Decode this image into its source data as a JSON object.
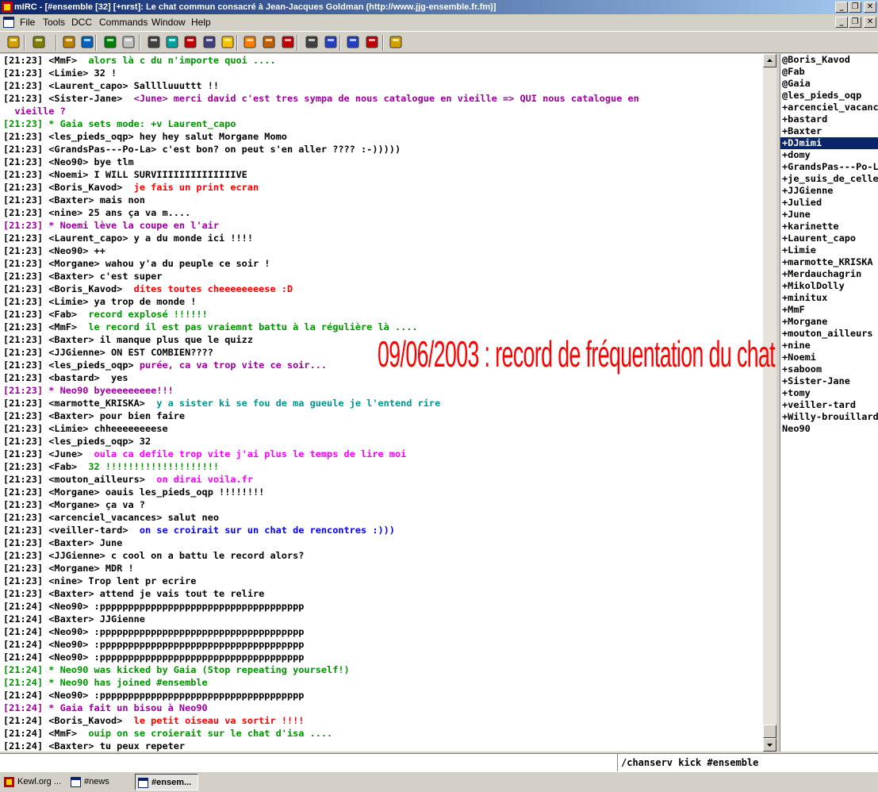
{
  "window": {
    "title": "mIRC - [#ensemble [32] [+nrst]: Le chat commun consacré à Jean-Jacques Goldman (http://www.jjg-ensemble.fr.fm)]"
  },
  "menu": [
    "File",
    "Tools",
    "DCC",
    "Commands",
    "Window",
    "Help"
  ],
  "toolbar_icons": [
    "connect-icon",
    "options-icon",
    "address-book-icon",
    "channels-icon",
    "scripts-icon",
    "timer-icon",
    "colors-icon",
    "notify-icon",
    "urls-icon",
    "logs-icon",
    "dcc-send-icon",
    "dcc-chat-icon",
    "dcc-options-icon",
    "tile-icon",
    "cascade-icon",
    "help-icon",
    "about-icon",
    "online-timer-icon",
    "colors-2-icon"
  ],
  "colors": {
    "black": "#000000",
    "green": "#009300",
    "purple": "#9c009c",
    "red": "#fc0000",
    "teal": "#009393",
    "magenta": "#ff00ff",
    "blue": "#0000fc",
    "selection": "#0a246a",
    "watermark": "#ff0000"
  },
  "chat_lines": [
    {
      "t": "[21:23] <MmF>  ",
      "m": "alors là c du n'importe quoi ....",
      "c": "green"
    },
    {
      "t": "[21:23] <Limie> 32 !",
      "m": "",
      "c": "black"
    },
    {
      "t": "[21:23] <Laurent_capo> Salllluuuttt !!",
      "m": "",
      "c": "black"
    },
    {
      "t": "[21:23] <Sister-Jane>  ",
      "m": "<June> merci david c'est tres sympa de nous catalogue en vieille => QUI nous catalogue en\n  vieille ?",
      "c": "purple",
      "wrap": true
    },
    {
      "t": "",
      "m": "[21:23] * Gaia sets mode: +v Laurent_capo",
      "c": "green"
    },
    {
      "t": "[21:23] <les_pieds_oqp> hey hey salut Morgane Momo",
      "m": "",
      "c": "black"
    },
    {
      "t": "[21:23] <GrandsPas---Po-La> c'est bon? on peut s'en aller ???? :-)))))",
      "m": "",
      "c": "black"
    },
    {
      "t": "[21:23] <Neo90> bye tlm",
      "m": "",
      "c": "black"
    },
    {
      "t": "[21:23] <Noemi> I WILL SURVIIIIIIIIIIIIIIVE",
      "m": "",
      "c": "black"
    },
    {
      "t": "[21:23] <Boris_Kavod>  ",
      "m": "je fais un print ecran",
      "c": "red"
    },
    {
      "t": "[21:23] <Baxter> mais non",
      "m": "",
      "c": "black"
    },
    {
      "t": "[21:23] <nine> 25 ans ça va m....",
      "m": "",
      "c": "black"
    },
    {
      "t": "",
      "m": "[21:23] * Noemi lève la coupe en l'air",
      "c": "purple"
    },
    {
      "t": "[21:23] <Laurent_capo> y a du monde ici !!!!",
      "m": "",
      "c": "black"
    },
    {
      "t": "[21:23] <Neo90> ++",
      "m": "",
      "c": "black"
    },
    {
      "t": "[21:23] <Morgane> wahou y'a du peuple ce soir !",
      "m": "",
      "c": "black"
    },
    {
      "t": "[21:23] <Baxter> c'est super",
      "m": "",
      "c": "black"
    },
    {
      "t": "[21:23] <Boris_Kavod>  ",
      "m": "dites toutes cheeeeeeeese :D",
      "c": "red"
    },
    {
      "t": "[21:23] <Limie> ya trop de monde !",
      "m": "",
      "c": "black"
    },
    {
      "t": "[21:23] <Fab>  ",
      "m": "record explosé !!!!!!",
      "c": "green"
    },
    {
      "t": "[21:23] <MmF>  ",
      "m": "le record il est pas vraiemnt battu à la régulière là ....",
      "c": "green"
    },
    {
      "t": "[21:23] <Baxter> il manque plus que le quizz",
      "m": "",
      "c": "black"
    },
    {
      "t": "[21:23] <JJGienne> ON EST COMBIEN????",
      "m": "",
      "c": "black"
    },
    {
      "t": "[21:23] <les_pieds_oqp> ",
      "m": "purée, ca va trop vite ce soir...",
      "c": "purple"
    },
    {
      "t": "[21:23] <bastard>  yes",
      "m": "",
      "c": "black"
    },
    {
      "t": "",
      "m": "[21:23] * Neo90 byeeeeeeeee!!!",
      "c": "purple"
    },
    {
      "t": "[21:23] <marmotte_KRISKA>  ",
      "m": "y a sister ki se fou de ma gueule je l'entend rire",
      "c": "teal"
    },
    {
      "t": "[21:23] <Baxter> pour bien faire",
      "m": "",
      "c": "black"
    },
    {
      "t": "[21:23] <Limie> chheeeeeeeese",
      "m": "",
      "c": "black"
    },
    {
      "t": "[21:23] <les_pieds_oqp> 32",
      "m": "",
      "c": "black"
    },
    {
      "t": "[21:23] <June>  ",
      "m": "oula ca defile trop vite j'ai plus le temps de lire moi",
      "c": "magenta"
    },
    {
      "t": "[21:23] <Fab>  ",
      "m": "32 !!!!!!!!!!!!!!!!!!!!",
      "c": "green"
    },
    {
      "t": "[21:23] <mouton_ailleurs>  ",
      "m": "on dirai voila.fr",
      "c": "magenta"
    },
    {
      "t": "[21:23] <Morgane> oauis les_pieds_oqp !!!!!!!!",
      "m": "",
      "c": "black"
    },
    {
      "t": "[21:23] <Morgane> ça va ?",
      "m": "",
      "c": "black"
    },
    {
      "t": "[21:23] <arcenciel_vacances> salut neo",
      "m": "",
      "c": "black"
    },
    {
      "t": "[21:23] <veiller-tard>  ",
      "m": "on se croirait sur un chat de rencontres :)))",
      "c": "blue"
    },
    {
      "t": "[21:23] <Baxter> June",
      "m": "",
      "c": "black"
    },
    {
      "t": "[21:23] <JJGienne> c cool on a battu le record alors?",
      "m": "",
      "c": "black"
    },
    {
      "t": "[21:23] <Morgane> MDR !",
      "m": "",
      "c": "black"
    },
    {
      "t": "[21:23] <nine> Trop lent pr ecrire",
      "m": "",
      "c": "black"
    },
    {
      "t": "[21:23] <Baxter> attend je vais tout te relire",
      "m": "",
      "c": "black"
    },
    {
      "t": "[21:24] <Neo90> :pppppppppppppppppppppppppppppppppppp",
      "m": "",
      "c": "black"
    },
    {
      "t": "[21:24] <Baxter> JJGienne",
      "m": "",
      "c": "black"
    },
    {
      "t": "[21:24] <Neo90> :pppppppppppppppppppppppppppppppppppp",
      "m": "",
      "c": "black"
    },
    {
      "t": "[21:24] <Neo90> :pppppppppppppppppppppppppppppppppppp",
      "m": "",
      "c": "black"
    },
    {
      "t": "[21:24] <Neo90> :pppppppppppppppppppppppppppppppppppp",
      "m": "",
      "c": "black"
    },
    {
      "t": "",
      "m": "[21:24] * Neo90 was kicked by Gaia (Stop repeating yourself!)",
      "c": "green"
    },
    {
      "t": "",
      "m": "[21:24] * Neo90 has joined #ensemble",
      "c": "green"
    },
    {
      "t": "[21:24] <Neo90> :pppppppppppppppppppppppppppppppppppp",
      "m": "",
      "c": "black"
    },
    {
      "t": "",
      "m": "[21:24] * Gaia fait un bisou à Neo90",
      "c": "purple"
    },
    {
      "t": "[21:24] <Boris_Kavod>  ",
      "m": "le petit oiseau va sortir !!!!",
      "c": "red"
    },
    {
      "t": "[21:24] <MmF>  ",
      "m": "ouip on se croierait sur le chat d'isa ....",
      "c": "green"
    },
    {
      "t": "[21:24] <Baxter> tu peux repeter",
      "m": "",
      "c": "black"
    }
  ],
  "nicklist": {
    "nicks": [
      "@Boris_Kavod",
      "@Fab",
      "@Gaia",
      "@les_pieds_oqp",
      "+arcenciel_vacances",
      "+bastard",
      "+Baxter",
      "+DJmimi",
      "+domy",
      "+GrandsPas---Po-La",
      "+je_suis_de_celles",
      "+JJGienne",
      "+Julied",
      "+June",
      "+karinette",
      "+Laurent_capo",
      "+Limie",
      "+marmotte_KRISKA",
      "+Merdauchagrin",
      "+MikolDolly",
      "+minitux",
      "+MmF",
      "+Morgane",
      "+mouton_ailleurs",
      "+nine",
      "+Noemi",
      "+saboom",
      "+Sister-Jane",
      "+tomy",
      "+veiller-tard",
      "+Willy-brouillard",
      "Neo90"
    ],
    "selected": "+DJmimi"
  },
  "input": {
    "value": "/chanserv kick #ensemble"
  },
  "taskbar": [
    {
      "label": "Kewl.org ...",
      "active": false
    },
    {
      "label": "#news",
      "active": false
    },
    {
      "label": "#ensem...",
      "active": true
    }
  ],
  "watermark": {
    "text": "09/06/2003 : record de fréquentation du chat"
  }
}
